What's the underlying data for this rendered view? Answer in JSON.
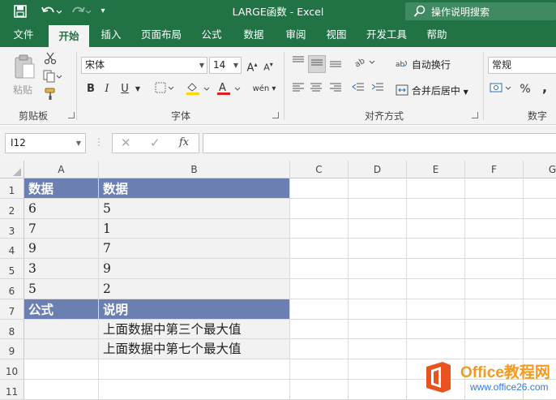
{
  "titlebar": {
    "title": "LARGE函数  -  Excel",
    "tell_me": "操作说明搜索",
    "quick_access": {
      "save": "save-icon",
      "undo": "undo-icon",
      "redo": "redo-icon",
      "customize": "customize-icon"
    },
    "bg_color": "#217346"
  },
  "tabs": [
    "文件",
    "开始",
    "插入",
    "页面布局",
    "公式",
    "数据",
    "审阅",
    "视图",
    "开发工具",
    "帮助"
  ],
  "active_tab": "开始",
  "ribbon": {
    "clipboard": {
      "paste": "粘贴",
      "group_label": "剪贴板"
    },
    "font": {
      "name": "宋体",
      "size": "14",
      "bold": "B",
      "italic": "I",
      "underline": "U",
      "phonetic": "wén",
      "group_label": "字体"
    },
    "alignment": {
      "wrap_text": "自动换行",
      "merge_center": "合并后居中",
      "group_label": "对齐方式"
    },
    "number": {
      "format": "常规",
      "percent": "%",
      "comma": ",",
      "group_label": "数字"
    }
  },
  "formula_bar": {
    "name_box": "I12",
    "cancel": "✕",
    "enter": "✓",
    "fx": "fx",
    "value": ""
  },
  "sheet": {
    "columns": [
      "A",
      "B",
      "C",
      "D",
      "E",
      "F",
      "G"
    ],
    "rows": [
      "1",
      "2",
      "3",
      "4",
      "5",
      "6",
      "7",
      "8",
      "9",
      "10",
      "11"
    ],
    "cells": {
      "A1": "数据",
      "B1": "数据",
      "A2": "6",
      "B2": "5",
      "A3": "7",
      "B3": "1",
      "A4": "9",
      "B4": "7",
      "A5": "3",
      "B5": "9",
      "A6": "5",
      "B6": "2",
      "A7": "公式",
      "B7": "说明",
      "A8": "",
      "B8": "上面数据中第三个最大值",
      "A9": "",
      "B9": "上面数据中第七个最大值"
    },
    "header_fill": "#6c7fb3",
    "data_fill": "#f2f2f2"
  },
  "watermark": {
    "main": "Office教程网",
    "sub": "www.office26.com"
  }
}
